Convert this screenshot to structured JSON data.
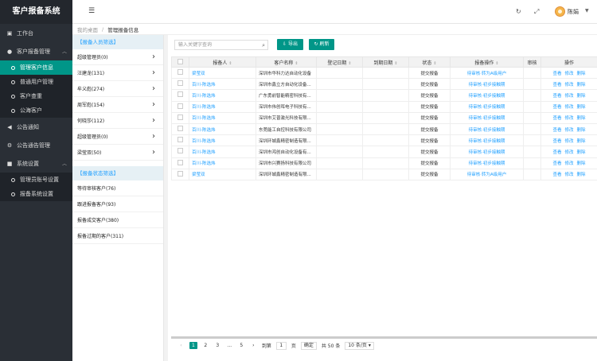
{
  "app": {
    "title": "客户报备系统"
  },
  "sidebar": {
    "items": [
      {
        "label": "工作台"
      },
      {
        "label": "客户报备管理"
      },
      {
        "label": "公告通知"
      },
      {
        "label": "公告通告管理"
      },
      {
        "label": "系统设置"
      }
    ],
    "sub_report": [
      {
        "label": "管理客户信息"
      },
      {
        "label": "普通用户管理"
      },
      {
        "label": "客户查重"
      },
      {
        "label": "公海客户"
      }
    ],
    "sub_system": [
      {
        "label": "管理员账号设置"
      },
      {
        "label": "报备系统设置"
      }
    ]
  },
  "header": {
    "user_name": "陈娟"
  },
  "breadcrumb": {
    "home": "我的桌面",
    "sep": "/",
    "current": "管理报备信息"
  },
  "filter": {
    "staff_title": "【报备人员筛选】",
    "staff": [
      {
        "label": "超级管理员(0)"
      },
      {
        "label": "汪建龙(131)"
      },
      {
        "label": "牟义彪(274)"
      },
      {
        "label": "周军彪(154)"
      },
      {
        "label": "何晓莎(112)"
      },
      {
        "label": "超级管理员(0)"
      },
      {
        "label": "梁莹双(50)"
      }
    ],
    "status_title": "【报备状态筛选】",
    "status": [
      {
        "label": "等待审核客户(76)"
      },
      {
        "label": "跟进报备客户(93)"
      },
      {
        "label": "报备成交客户(380)"
      },
      {
        "label": "报备过期的客户(311)"
      }
    ]
  },
  "toolbar": {
    "search_placeholder": "输入关键字查询",
    "export_label": "导出",
    "refresh_label": "刷新"
  },
  "table": {
    "headers": [
      "报备人",
      "客户名称",
      "登记日期",
      "到期日期",
      "状态",
      "报备操作",
      "审核",
      "操作"
    ],
    "rows": [
      {
        "reporter": "梁莹双",
        "customer": "深圳市华科力达自动化设备",
        "reg": "",
        "due": "",
        "status": "提交报备",
        "action": "待审核·转为A级用户",
        "ops": [
          "查看",
          "修改",
          "删除"
        ]
      },
      {
        "reporter": "百川-陈选炜",
        "customer": "深圳市鑫立方自动化设备...",
        "reg": "",
        "due": "",
        "status": "提交报备",
        "action": "待审核·初步接触期",
        "ops": [
          "查看",
          "修改",
          "删除"
        ]
      },
      {
        "reporter": "百川-陈选炜",
        "customer": "广东勇前智能精密科技有...",
        "reg": "",
        "due": "",
        "status": "提交报备",
        "action": "待审核·初步接触期",
        "ops": [
          "查看",
          "修改",
          "删除"
        ]
      },
      {
        "reporter": "百川-陈选炜",
        "customer": "深圳市伟创晖电子科技有...",
        "reg": "",
        "due": "",
        "status": "提交报备",
        "action": "待审核·初步接触期",
        "ops": [
          "查看",
          "修改",
          "删除"
        ]
      },
      {
        "reporter": "百川-陈选炜",
        "customer": "深圳市艾普激光科技有限...",
        "reg": "",
        "due": "",
        "status": "提交报备",
        "action": "待审核·初步接触期",
        "ops": [
          "查看",
          "修改",
          "删除"
        ]
      },
      {
        "reporter": "百川-陈选炜",
        "customer": "东莞能工自控科技有限公司",
        "reg": "",
        "due": "",
        "status": "提交报备",
        "action": "待审核·初步接触期",
        "ops": [
          "查看",
          "修改",
          "删除"
        ]
      },
      {
        "reporter": "百川-陈选炜",
        "customer": "深圳环城鑫精密制造有限...",
        "reg": "",
        "due": "",
        "status": "提交报备",
        "action": "待审核·初步接触期",
        "ops": [
          "查看",
          "修改",
          "删除"
        ]
      },
      {
        "reporter": "百川-陈选炜",
        "customer": "深圳市鸿创自动化设备有...",
        "reg": "",
        "due": "",
        "status": "提交报备",
        "action": "待审核·初步接触期",
        "ops": [
          "查看",
          "修改",
          "删除"
        ]
      },
      {
        "reporter": "百川-陈选炜",
        "customer": "深圳市兴赛扬科技有限公司",
        "reg": "",
        "due": "",
        "status": "提交报备",
        "action": "待审核·初步接触期",
        "ops": [
          "查看",
          "修改",
          "删除"
        ]
      },
      {
        "reporter": "梁莹双",
        "customer": "深圳环城鑫精密制造有限...",
        "reg": "",
        "due": "",
        "status": "提交报备",
        "action": "待审核·转为A级用户",
        "ops": [
          "查看",
          "修改",
          "删除"
        ]
      }
    ]
  },
  "pagination": {
    "pages": [
      "1",
      "2",
      "3",
      "...",
      "5"
    ],
    "goto_label": "到第",
    "goto_value": "1",
    "page_unit": "页",
    "confirm_label": "确定",
    "total": "共 50 条",
    "per_page": "10 条/页"
  }
}
